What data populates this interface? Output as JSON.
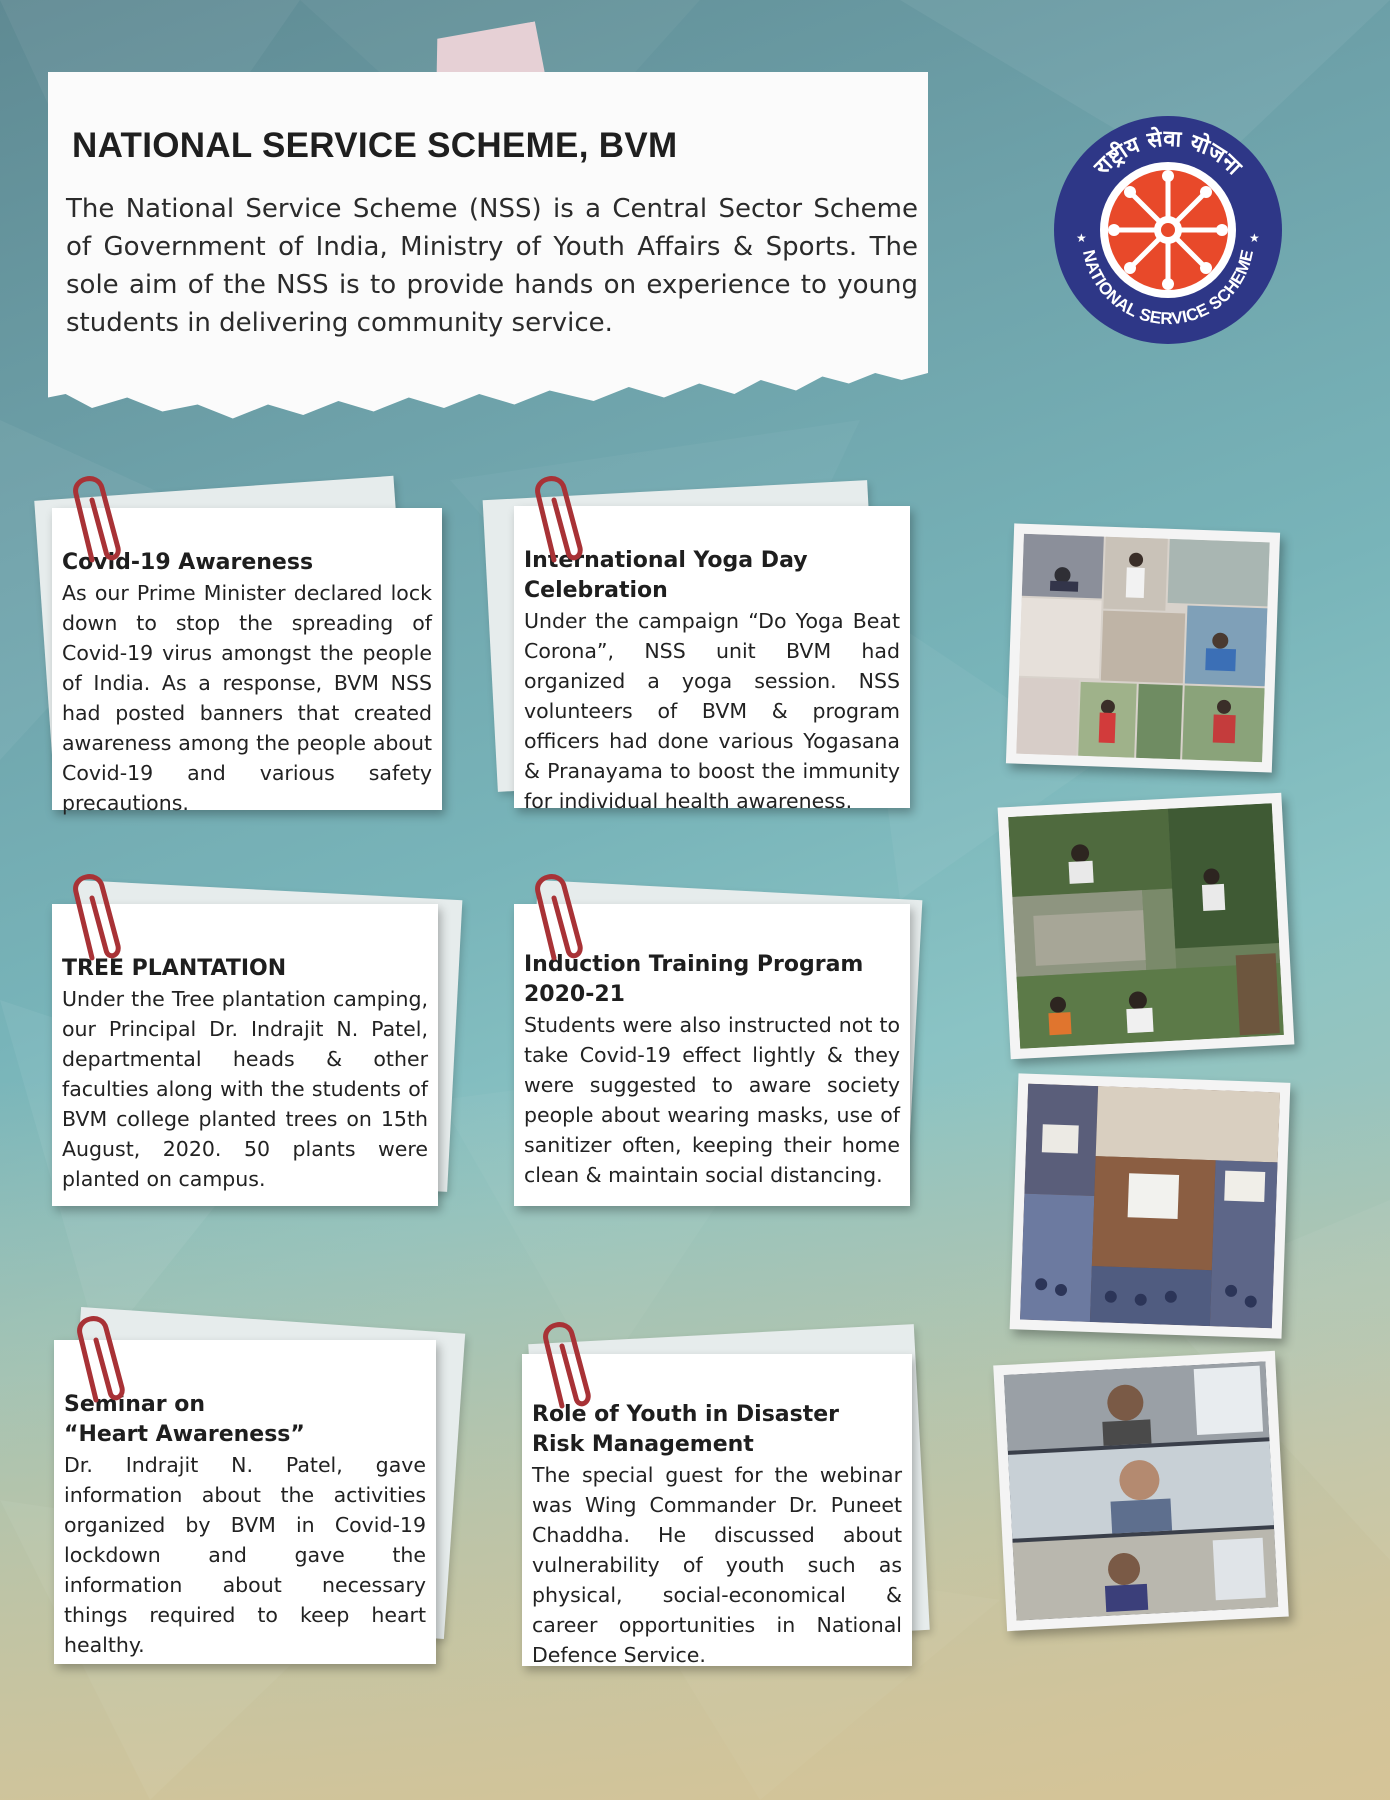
{
  "header": {
    "title": "NATIONAL SERVICE SCHEME, BVM",
    "description": "The National Service Scheme (NSS) is a Central Sector Scheme of Government of India, Ministry of Youth Affairs & Sports. The sole aim of the NSS is to provide hands on experience to young students in delivering community service."
  },
  "logo": {
    "top_text": "राष्ट्रीय सेवा योजना",
    "bottom_text": "NATIONAL SERVICE SCHEME",
    "ring_color": "#2e3787",
    "wheel_color": "#e8492a"
  },
  "cards": [
    {
      "title": "Covid-19 Awareness",
      "body": "As our Prime Minister declared lock down to stop the spreading of Covid-19 virus amongst the people of India. As a response, BVM NSS had posted banners that created awareness among the people about Covid-19 and various safety precautions."
    },
    {
      "title": "International Yoga Day\nCelebration",
      "body": "Under the campaign “Do Yoga Beat Corona”, NSS unit BVM had organized a yoga session. NSS volunteers of BVM & program officers had done various Yogasana & Pranayama to boost the immunity for individual health awareness."
    },
    {
      "title": "TREE PLANTATION",
      "body": "Under the Tree plantation camping, our Principal Dr. Indrajit N. Patel, departmental heads & other faculties along with the students of BVM college planted trees on 15th August, 2020. 50 plants were planted on campus."
    },
    {
      "title": "Induction Training Program\n2020-21",
      "body": "Students were also instructed not to take Covid-19 effect lightly & they were suggested to aware society people about wearing masks, use of sanitizer often, keeping their home clean & maintain social distancing."
    },
    {
      "title": "Seminar on\n“Heart Awareness”",
      "body": "Dr. Indrajit N. Patel, gave information about the activities organized by BVM in Covid-19 lockdown and gave the information about necessary things required to keep heart healthy."
    },
    {
      "title": "Role of Youth in Disaster\nRisk Management",
      "body": "The special guest for the webinar was Wing Commander Dr. Puneet Chaddha. He discussed about vulnerability of youth such as physical, social-economical & career opportunities in National Defence Service."
    }
  ],
  "photos": [
    {
      "name": "yoga-day-photo-collage"
    },
    {
      "name": "tree-plantation-photo-collage"
    },
    {
      "name": "induction-program-photo-collage"
    },
    {
      "name": "webinar-screenshot-photo"
    }
  ]
}
